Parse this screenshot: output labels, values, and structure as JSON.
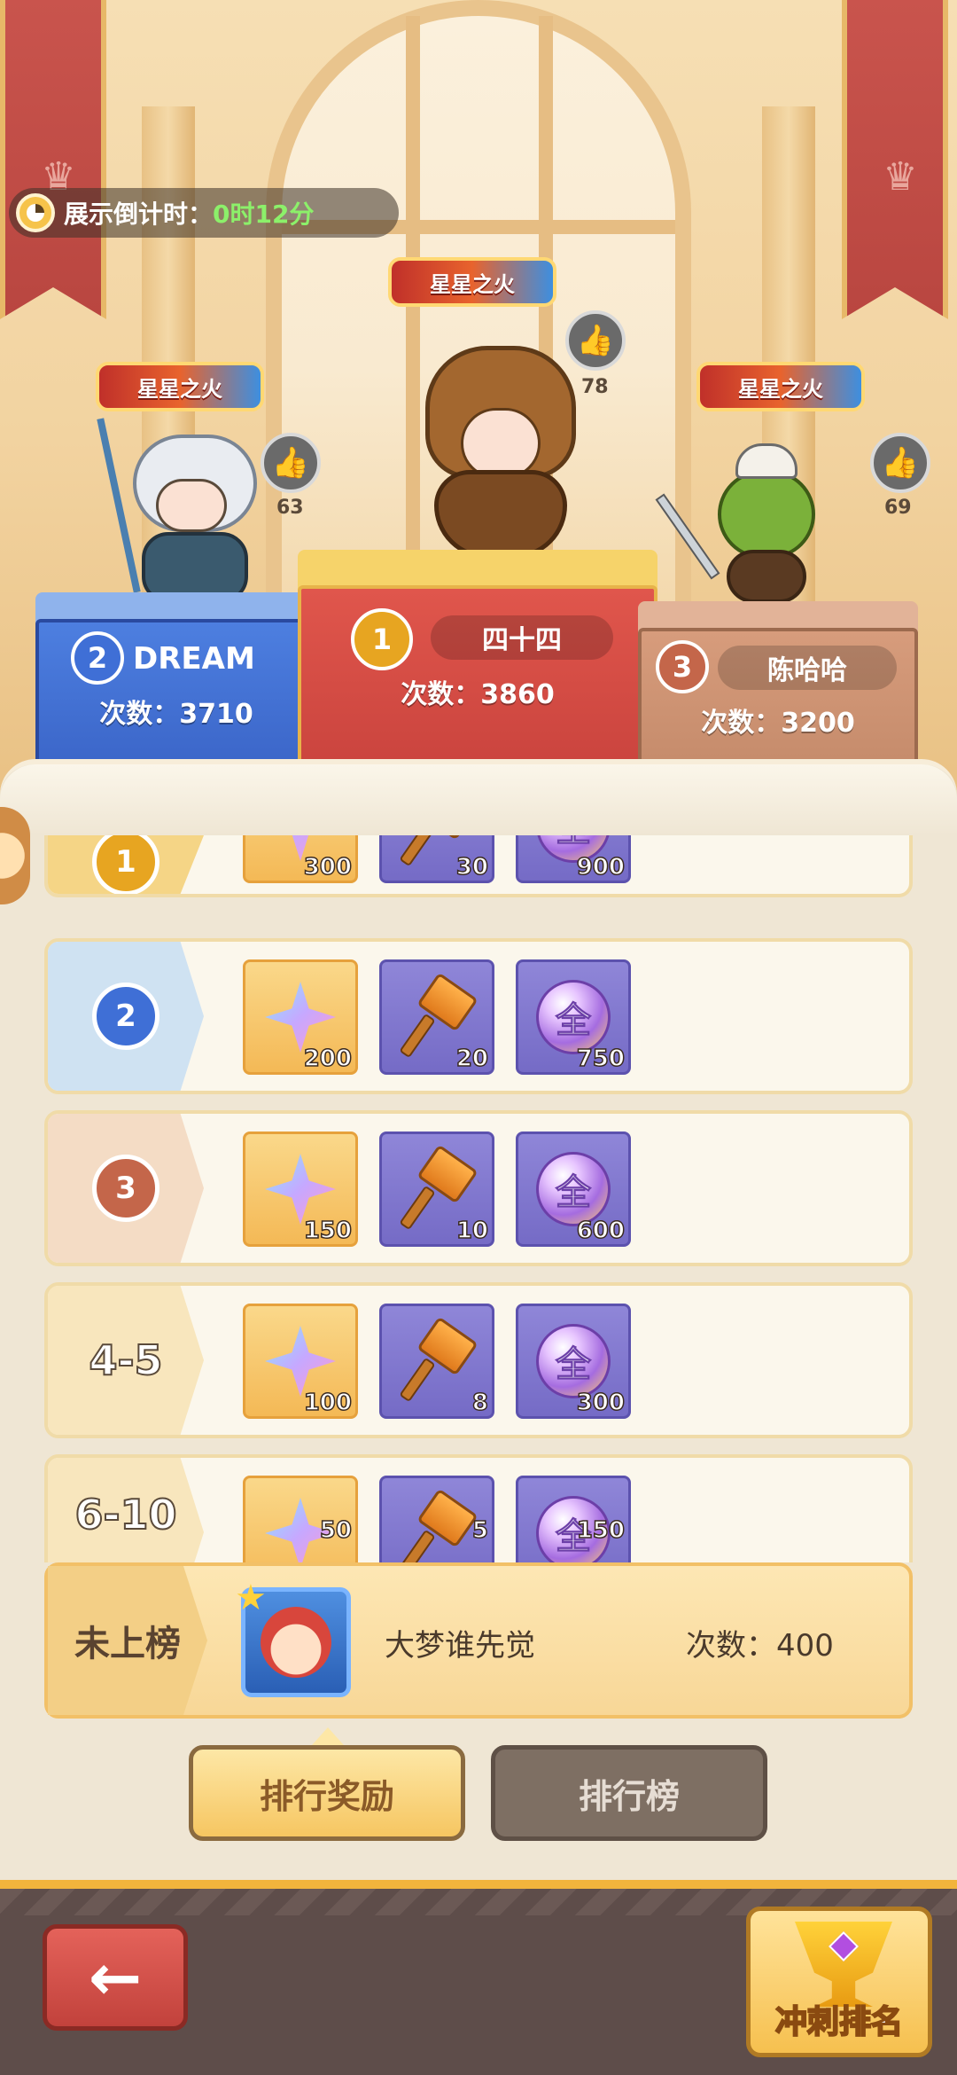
{
  "timer": {
    "label": "展示倒计时：",
    "value": "0时12分"
  },
  "podium": {
    "first": {
      "rank": "1",
      "title": "星星之火",
      "name": "四十四",
      "likes": "78",
      "count_label": "次数：3860"
    },
    "second": {
      "rank": "2",
      "title": "星星之火",
      "name": "DREAM",
      "likes": "63",
      "count_label": "次数：3710"
    },
    "third": {
      "rank": "3",
      "title": "星星之火",
      "name": "陈哈哈",
      "likes": "69",
      "count_label": "次数：3200"
    }
  },
  "rewards": [
    {
      "rank": "1",
      "items": [
        {
          "icon": "star-gem-icon",
          "qty": "300"
        },
        {
          "icon": "hammer-icon",
          "qty": "30"
        },
        {
          "icon": "all-orb-icon",
          "qty": "900"
        }
      ]
    },
    {
      "rank": "2",
      "items": [
        {
          "icon": "star-gem-icon",
          "qty": "200"
        },
        {
          "icon": "hammer-icon",
          "qty": "20"
        },
        {
          "icon": "all-orb-icon",
          "qty": "750"
        }
      ]
    },
    {
      "rank": "3",
      "items": [
        {
          "icon": "star-gem-icon",
          "qty": "150"
        },
        {
          "icon": "hammer-icon",
          "qty": "10"
        },
        {
          "icon": "all-orb-icon",
          "qty": "600"
        }
      ]
    },
    {
      "rank": "4-5",
      "items": [
        {
          "icon": "star-gem-icon",
          "qty": "100"
        },
        {
          "icon": "hammer-icon",
          "qty": "8"
        },
        {
          "icon": "all-orb-icon",
          "qty": "300"
        }
      ]
    },
    {
      "rank": "6-10",
      "items": [
        {
          "icon": "star-gem-icon",
          "qty": "50"
        },
        {
          "icon": "hammer-icon",
          "qty": "5"
        },
        {
          "icon": "all-orb-icon",
          "qty": "150"
        }
      ]
    }
  ],
  "orb_glyph": "全",
  "my_rank": {
    "status": "未上榜",
    "name": "大梦谁先觉",
    "count_label": "次数：400"
  },
  "tabs": {
    "rewards": "排行奖励",
    "leaderboard": "排行榜"
  },
  "buttons": {
    "back": "←",
    "sprint": "冲刺排名"
  },
  "colors": {
    "first": "#d9504a",
    "second": "#3f6fd6",
    "third": "#c48a6a",
    "accent": "#f6c661"
  }
}
